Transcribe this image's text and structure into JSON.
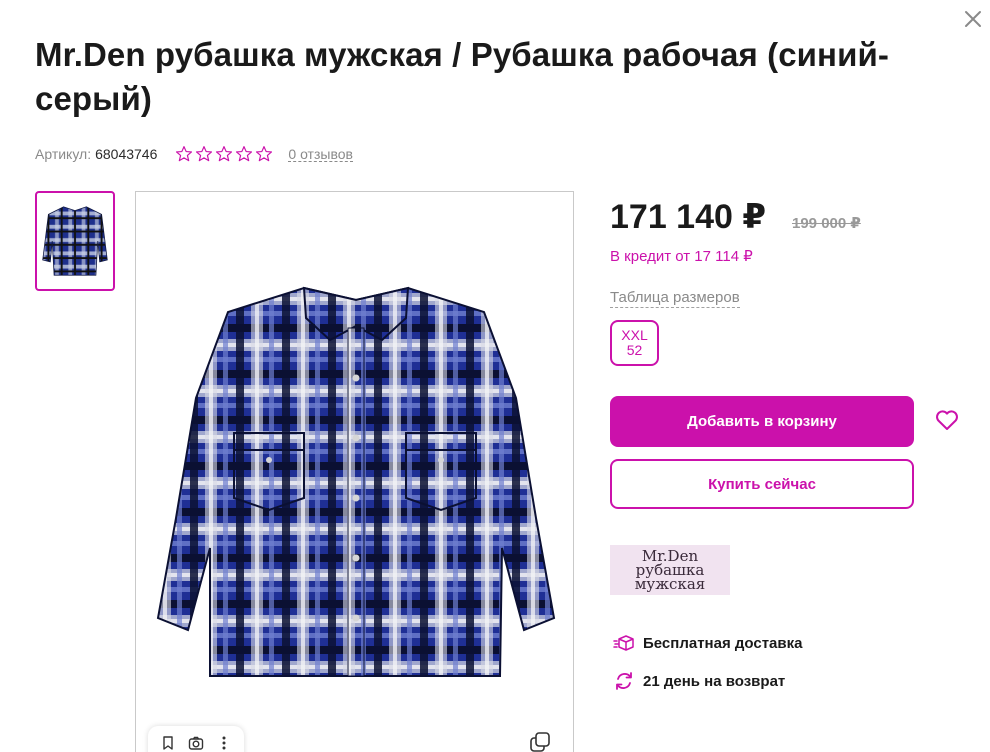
{
  "product": {
    "title": "Mr.Den рубашка мужская / Рубашка рабочая (синий-серый)",
    "sku_label": "Артикул:",
    "sku_value": "68043746",
    "rating": 0,
    "rating_max": 5,
    "reviews_label": "0 отзывов"
  },
  "pricing": {
    "price": "171 140 ₽",
    "old_price": "199 000 ₽",
    "credit": "В кредит от 17 114 ₽"
  },
  "sizes": {
    "table_link": "Таблица размеров",
    "options": [
      {
        "label": "XXL",
        "ru": "52"
      }
    ]
  },
  "actions": {
    "add_to_cart": "Добавить в корзину",
    "buy_now": "Купить сейчас"
  },
  "brand": {
    "logo_lines": [
      "Mr.Den",
      "рубашка",
      "мужская"
    ]
  },
  "features": {
    "delivery": "Бесплатная доставка",
    "returns": "21 день на возврат"
  },
  "colors": {
    "accent": "#cb11ab",
    "text": "#1a1a1a",
    "muted": "#8a8a8a"
  },
  "icons": {
    "close": "close-icon",
    "star": "star-outline-icon",
    "favorite": "heart-icon",
    "delivery": "box-icon",
    "returns": "refresh-icon",
    "bookmark": "bookmark-icon",
    "camera": "camera-icon",
    "more": "more-vertical-icon",
    "copy": "copy-icon"
  }
}
